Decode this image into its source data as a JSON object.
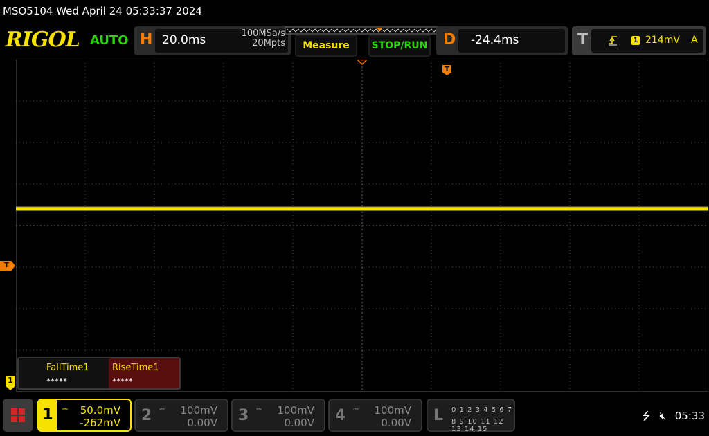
{
  "title_bar": {
    "text": "MSO5104  Wed April 24 05:33:37 2024"
  },
  "brand": {
    "logo": "RIGOL",
    "mode": "AUTO"
  },
  "horizontal": {
    "letter": "H",
    "timebase": "20.0ms",
    "sample_rate": "100MSa/s",
    "memory_depth": "20Mpts"
  },
  "buttons": {
    "measure": "Measure",
    "stop_run": "STOP/RUN"
  },
  "delay": {
    "letter": "D",
    "value": "-24.4ms"
  },
  "trigger": {
    "letter": "T",
    "source_badge": "1",
    "level": "214mV",
    "mode": "A",
    "edge_icon": "rising-edge-icon"
  },
  "markers": {
    "trigger_position": "T",
    "trigger_level": "T",
    "channel1": "1"
  },
  "measurements": [
    {
      "label": "FallTime1",
      "value": "*****"
    },
    {
      "label": "RiseTime1",
      "value": "*****"
    }
  ],
  "channels": [
    {
      "num": "1",
      "scale": "50.0mV",
      "offset": "-262mV",
      "active": true
    },
    {
      "num": "2",
      "scale": "100mV",
      "offset": "0.00V",
      "active": false
    },
    {
      "num": "3",
      "scale": "100mV",
      "offset": "0.00V",
      "active": false
    },
    {
      "num": "4",
      "scale": "100mV",
      "offset": "0.00V",
      "active": false
    }
  ],
  "logic": {
    "letter": "L",
    "row1": "0 1 2 3   4 5 6 7",
    "row2": "8 9 10 11 12 13 14 15"
  },
  "status": {
    "time": "05:33",
    "usb_icon": "usb-icon",
    "sound_icon": "speaker-muted-icon"
  },
  "colors": {
    "ch1": "#f6e100",
    "accent": "#f07d00",
    "run": "#27d800",
    "grid": "#5a5a5a"
  }
}
